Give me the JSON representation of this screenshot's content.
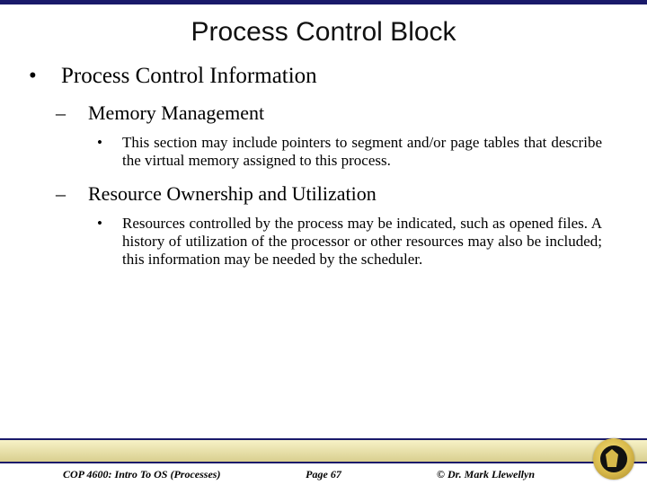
{
  "title": "Process Control Block",
  "lvl1": "Process Control Information",
  "section1": {
    "heading": "Memory Management",
    "body": "This section may include pointers to segment and/or page tables that describe the virtual memory assigned to this process."
  },
  "section2": {
    "heading": "Resource Ownership and Utilization",
    "body": "Resources controlled by the process may be indicated, such as opened files. A history of utilization of the processor or other resources may also be included; this information may be needed by the scheduler."
  },
  "footer": {
    "left": "COP 4600: Intro To OS  (Processes)",
    "center": "Page 67",
    "right": "© Dr. Mark Llewellyn"
  }
}
